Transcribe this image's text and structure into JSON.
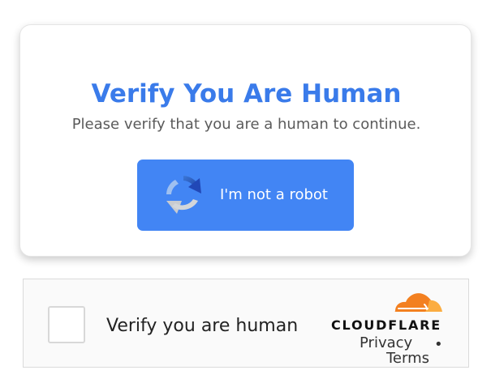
{
  "verification_card": {
    "title": "Verify You Are Human",
    "subtitle": "Please verify that you are a human to continue.",
    "button_label": "I'm not a robot",
    "button_icon": "recaptcha-icon",
    "colors": {
      "title": "#3a7bea",
      "button": "#4285f4",
      "button_text": "#ffffff"
    }
  },
  "turnstile": {
    "checkbox_checked": false,
    "label": "Verify you are human",
    "brand": "CLOUDFLARE",
    "brand_icon": "cloudflare-cloud-icon",
    "privacy_link": "Privacy",
    "separator": "•",
    "terms_link": "Terms",
    "colors": {
      "cloud_orange": "#f38020",
      "cloud_light_orange": "#fbad41"
    }
  }
}
